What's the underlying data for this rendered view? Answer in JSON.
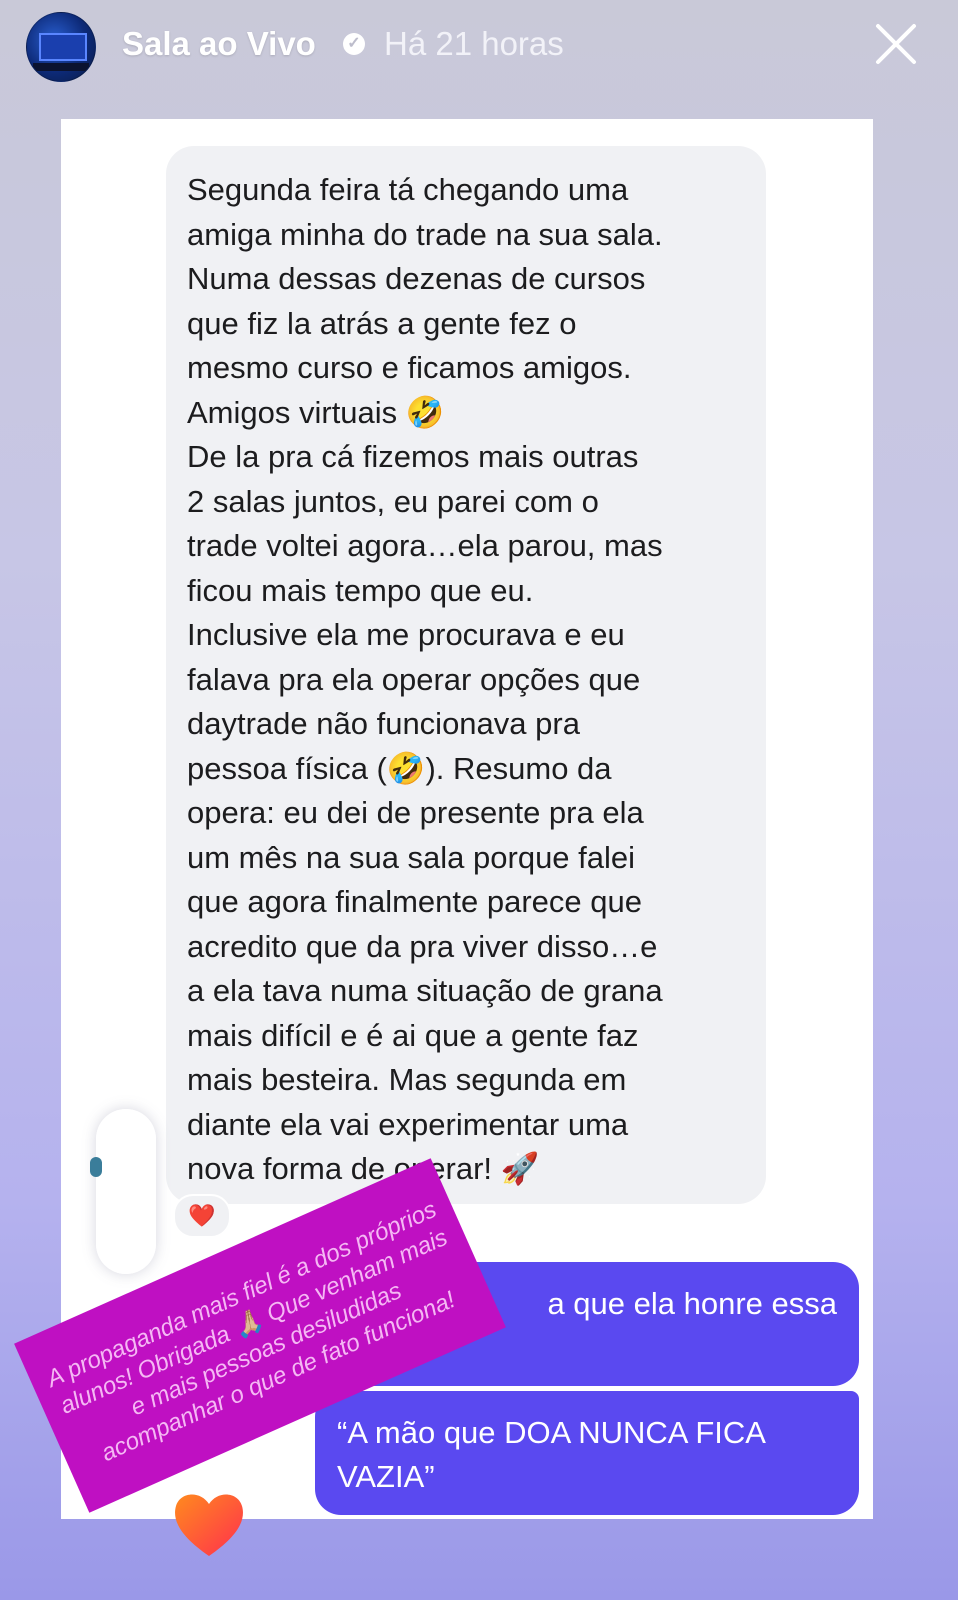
{
  "story": {
    "account_name": "Sala ao Vivo",
    "verified_badge": "verified-icon",
    "time_ago": "Há 21 horas",
    "close_icon": "close-icon"
  },
  "chat": {
    "incoming_message": "Segunda feira tá chegando uma\namiga minha do trade na sua sala.\nNuma dessas dezenas de cursos\nque fiz la atrás a gente fez o\nmesmo curso e ficamos amigos.\nAmigos virtuais 🤣\nDe la pra cá fizemos mais outras\n2 salas juntos, eu parei com o\ntrade voltei agora…ela parou, mas\nficou mais tempo que eu.\nInclusive ela me procurava e eu\nfalava pra ela operar opções que\ndaytrade não funcionava pra\npessoa física (🤣). Resumo da\nopera: eu dei de presente pra ela\num mês na sua sala porque falei\nque agora finalmente parece que\nacredito que da pra viver disso…e\na ela tava numa situação de grana\nmais difícil e é ai que a gente faz\nmais besteira. Mas segunda em\ndiante ela vai experimentar uma\nnova forma de operar! 🚀",
    "reaction": "❤️",
    "outgoing_message_1": "a que ela honre essa",
    "outgoing_message_2": "“A mão que DOA NUNCA FICA VAZIA”"
  },
  "sticker": {
    "text": "A propaganda mais fiel é a dos próprios alunos! Obrigada 🙏🏼 Que venham mais e mais pessoas desiludidas acompanhar o que de fato funciona!"
  },
  "colors": {
    "incoming_bubble": "#f0f1f4",
    "outgoing_bubble": "#5a49f0",
    "sticker_background": "#bf10c2",
    "sticker_text": "#f5b8f4"
  }
}
